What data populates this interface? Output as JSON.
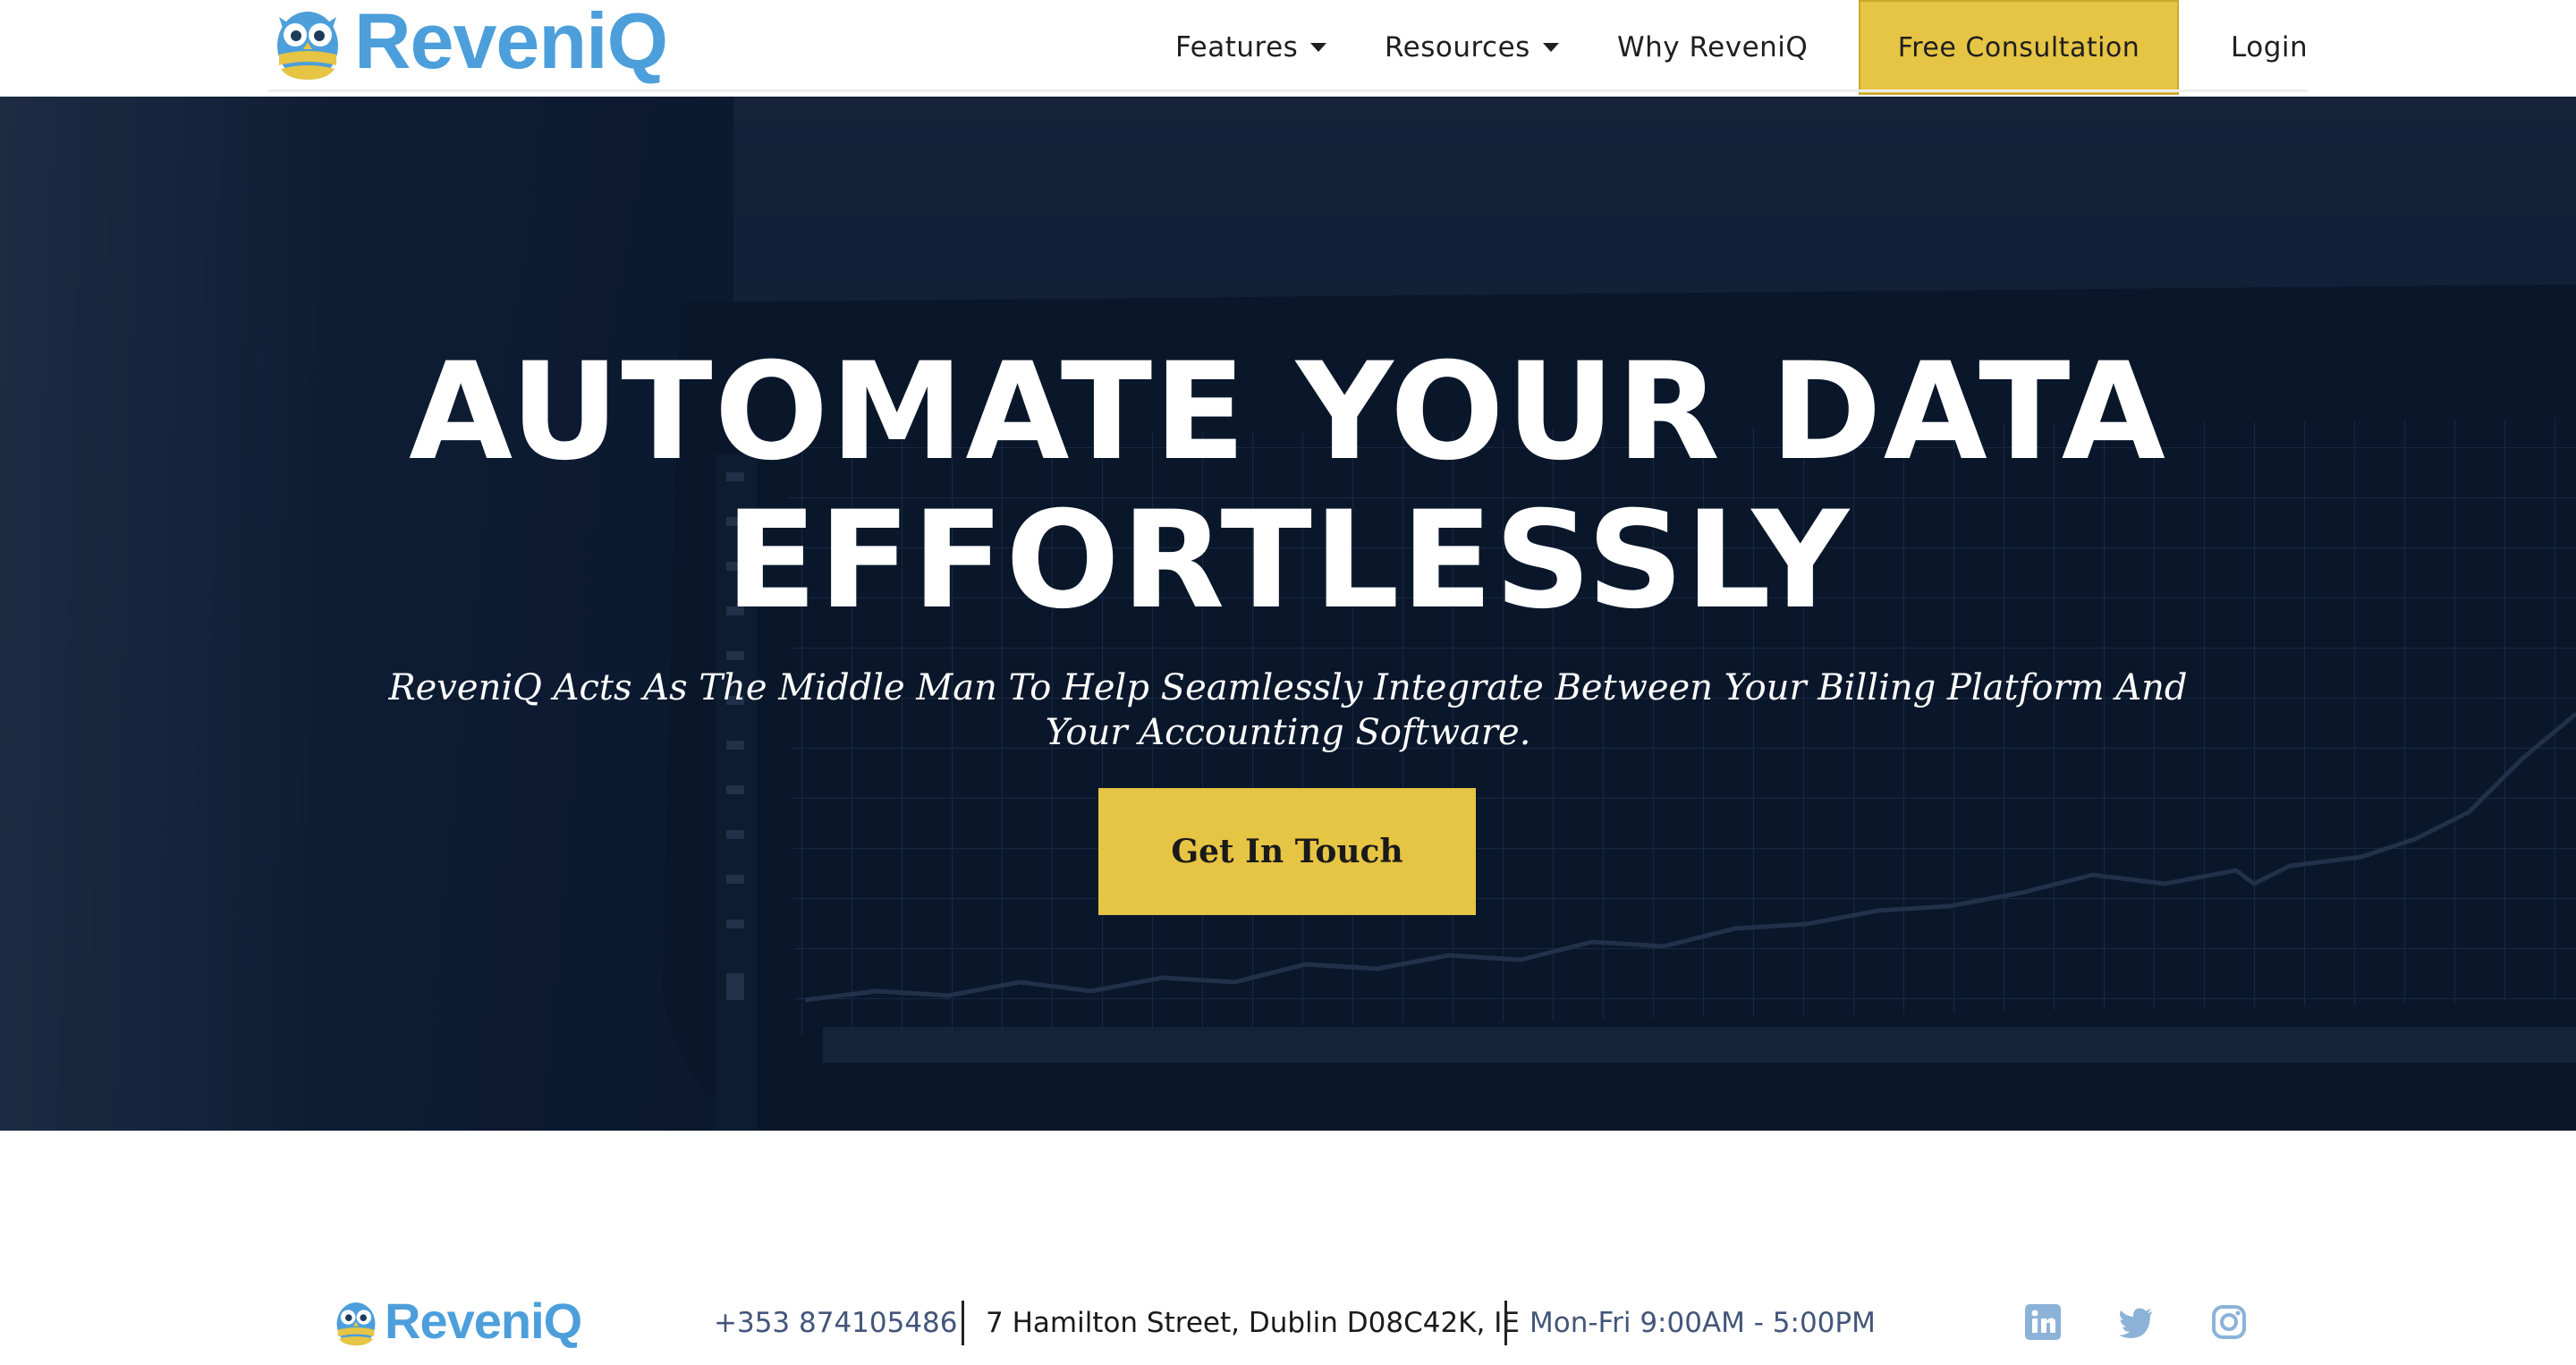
{
  "brand": {
    "name": "ReveniQ",
    "text_color": "#4c9fdb",
    "owl_blue": "#4c9fdb",
    "owl_yellow": "#e6c444"
  },
  "nav": {
    "items": [
      {
        "label": "Features",
        "has_dropdown": true
      },
      {
        "label": "Resources",
        "has_dropdown": true
      },
      {
        "label": "Why ReveniQ",
        "has_dropdown": false
      }
    ],
    "cta_label": "Free Consultation",
    "login_label": "Login"
  },
  "hero": {
    "title_line1": "AUTOMATE YOUR DATA",
    "title_line2": "EFFORTLESSLY",
    "subtitle": "ReveniQ Acts As The Middle Man To Help Seamlessly Integrate Between Your Billing Platform And Your Accounting Software.",
    "button_label": "Get In Touch"
  },
  "footer": {
    "phone": "+353 874105486",
    "address": "7 Hamilton Street, Dublin D08C42K, IE",
    "hours": "Mon-Fri 9:00AM - 5:00PM",
    "social": [
      "linkedin-icon",
      "twitter-icon",
      "instagram-icon"
    ]
  },
  "colors": {
    "accent_yellow": "#e6c444",
    "hero_navy": "#0f1c31",
    "footer_muted": "#43557a",
    "social_blue": "#8cb2d8"
  }
}
